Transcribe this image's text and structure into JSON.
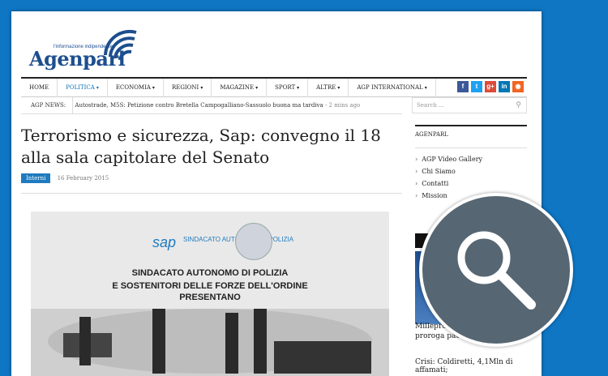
{
  "brand": {
    "name": "Agenparl",
    "tagline": "l'informazione indipendente"
  },
  "nav": {
    "items": [
      {
        "label": "HOME",
        "caret": ""
      },
      {
        "label": "POLITICA",
        "caret": "▾"
      },
      {
        "label": "ECONOMIA",
        "caret": "▾"
      },
      {
        "label": "REGIONI",
        "caret": "▾"
      },
      {
        "label": "MAGAZINE",
        "caret": "▾"
      },
      {
        "label": "SPORT",
        "caret": "▾"
      },
      {
        "label": "ALTRE",
        "caret": "▾"
      },
      {
        "label": "AGP INTERNATIONAL",
        "caret": "▾"
      }
    ],
    "social": [
      {
        "icon": "facebook-icon",
        "glyph": "f",
        "color": "#3b5998"
      },
      {
        "icon": "twitter-icon",
        "glyph": "t",
        "color": "#1da1f2"
      },
      {
        "icon": "googleplus-icon",
        "glyph": "g+",
        "color": "#dd4b39"
      },
      {
        "icon": "linkedin-icon",
        "glyph": "in",
        "color": "#0077b5"
      },
      {
        "icon": "rss-icon",
        "glyph": "◉",
        "color": "#f26522"
      }
    ]
  },
  "ticker": {
    "label": "AGP NEWS:",
    "headline": "Autostrade, M5S: Petizione contro Bretella Campogalliano-Sassuolo buona ma tardiva",
    "ago": "- 2 mins ago"
  },
  "search": {
    "placeholder": "Search ..."
  },
  "article": {
    "title": "Terrorismo e sicurezza, Sap: convegno il 18 alla sala capitolare del Senato",
    "category": "Interni",
    "date": "16 February 2015"
  },
  "poster": {
    "logo_sap": "sap",
    "org_short": "SINDACATO AUTONOMO di POLIZIA",
    "line1": "SINDACATO AUTONOMO DI POLIZIA",
    "line2": "E SOSTENITORI DELLE FORZE DELL'ORDINE",
    "line3": "PRESENTANO"
  },
  "sidebar": {
    "heading": "AGENPARL",
    "links": [
      "AGP Video Gallery",
      "Chi Siamo",
      "Contatti",
      "Mission"
    ],
    "story1": "Millepro",
    "story1b": "proroga pat",
    "story2": "Crisi: Coldiretti, 4,1Mln di affamati;"
  },
  "colors": {
    "accent": "#1f7bbf",
    "background": "#0f76c4",
    "zoom": "#566672"
  }
}
